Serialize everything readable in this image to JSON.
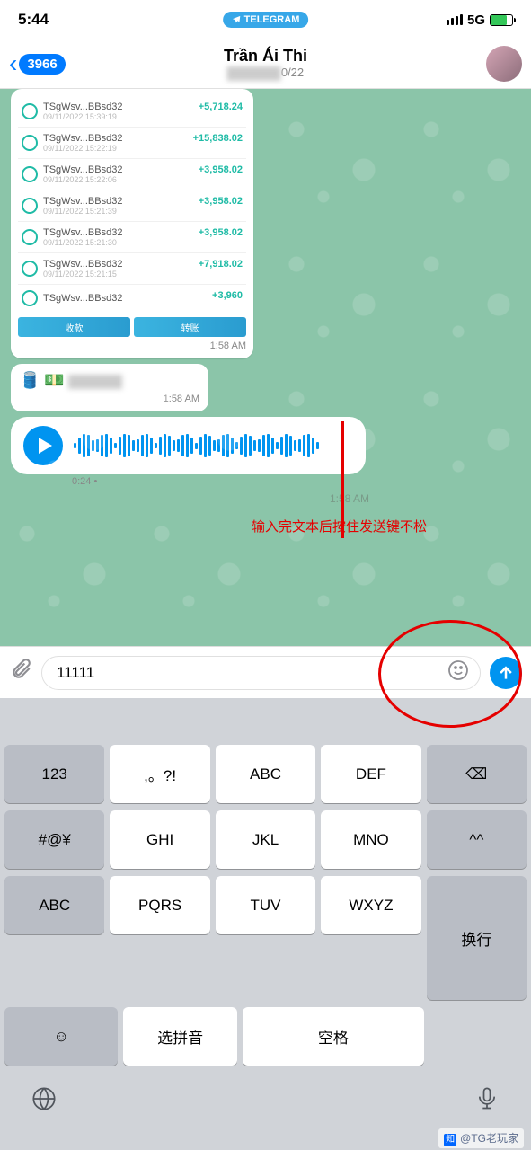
{
  "status": {
    "time": "5:44",
    "app_pill": "TELEGRAM",
    "network": "5G"
  },
  "header": {
    "back_count": "3966",
    "title": "Trần Ái Thi",
    "subtitle": "0/22"
  },
  "transactions": [
    {
      "name": "TSgWsv...BBsd32",
      "date": "09/11/2022 15:39:19",
      "amount": "+5,718.24"
    },
    {
      "name": "TSgWsv...BBsd32",
      "date": "09/11/2022 15:22:19",
      "amount": "+15,838.02"
    },
    {
      "name": "TSgWsv...BBsd32",
      "date": "09/11/2022 15:22:06",
      "amount": "+3,958.02"
    },
    {
      "name": "TSgWsv...BBsd32",
      "date": "09/11/2022 15:21:39",
      "amount": "+3,958.02"
    },
    {
      "name": "TSgWsv...BBsd32",
      "date": "09/11/2022 15:21:30",
      "amount": "+3,958.02"
    },
    {
      "name": "TSgWsv...BBsd32",
      "date": "09/11/2022 15:21:15",
      "amount": "+7,918.02"
    },
    {
      "name": "TSgWsv...BBsd32",
      "date": "",
      "amount": "+3,960"
    }
  ],
  "tx_buttons": {
    "left": "收款",
    "right": "转账"
  },
  "msg_times": {
    "tx": "1:58 AM",
    "emoji": "1:58 AM",
    "voice": "1:58 AM"
  },
  "emoji_msg": "🛢️ 💵",
  "voice": {
    "duration": "0:24"
  },
  "annotation": "输入完文本后按住发送键不松",
  "input": {
    "value": "11111"
  },
  "keyboard": {
    "row1": [
      "123",
      ",。?!",
      "ABC",
      "DEF",
      "⌫"
    ],
    "row2": [
      "#@¥",
      "GHI",
      "JKL",
      "MNO",
      "^^"
    ],
    "row3": [
      "ABC",
      "PQRS",
      "TUV",
      "WXYZ",
      "换行"
    ],
    "row4": [
      "☺",
      "选拼音",
      "空格"
    ]
  },
  "credit": "@TG老玩家"
}
